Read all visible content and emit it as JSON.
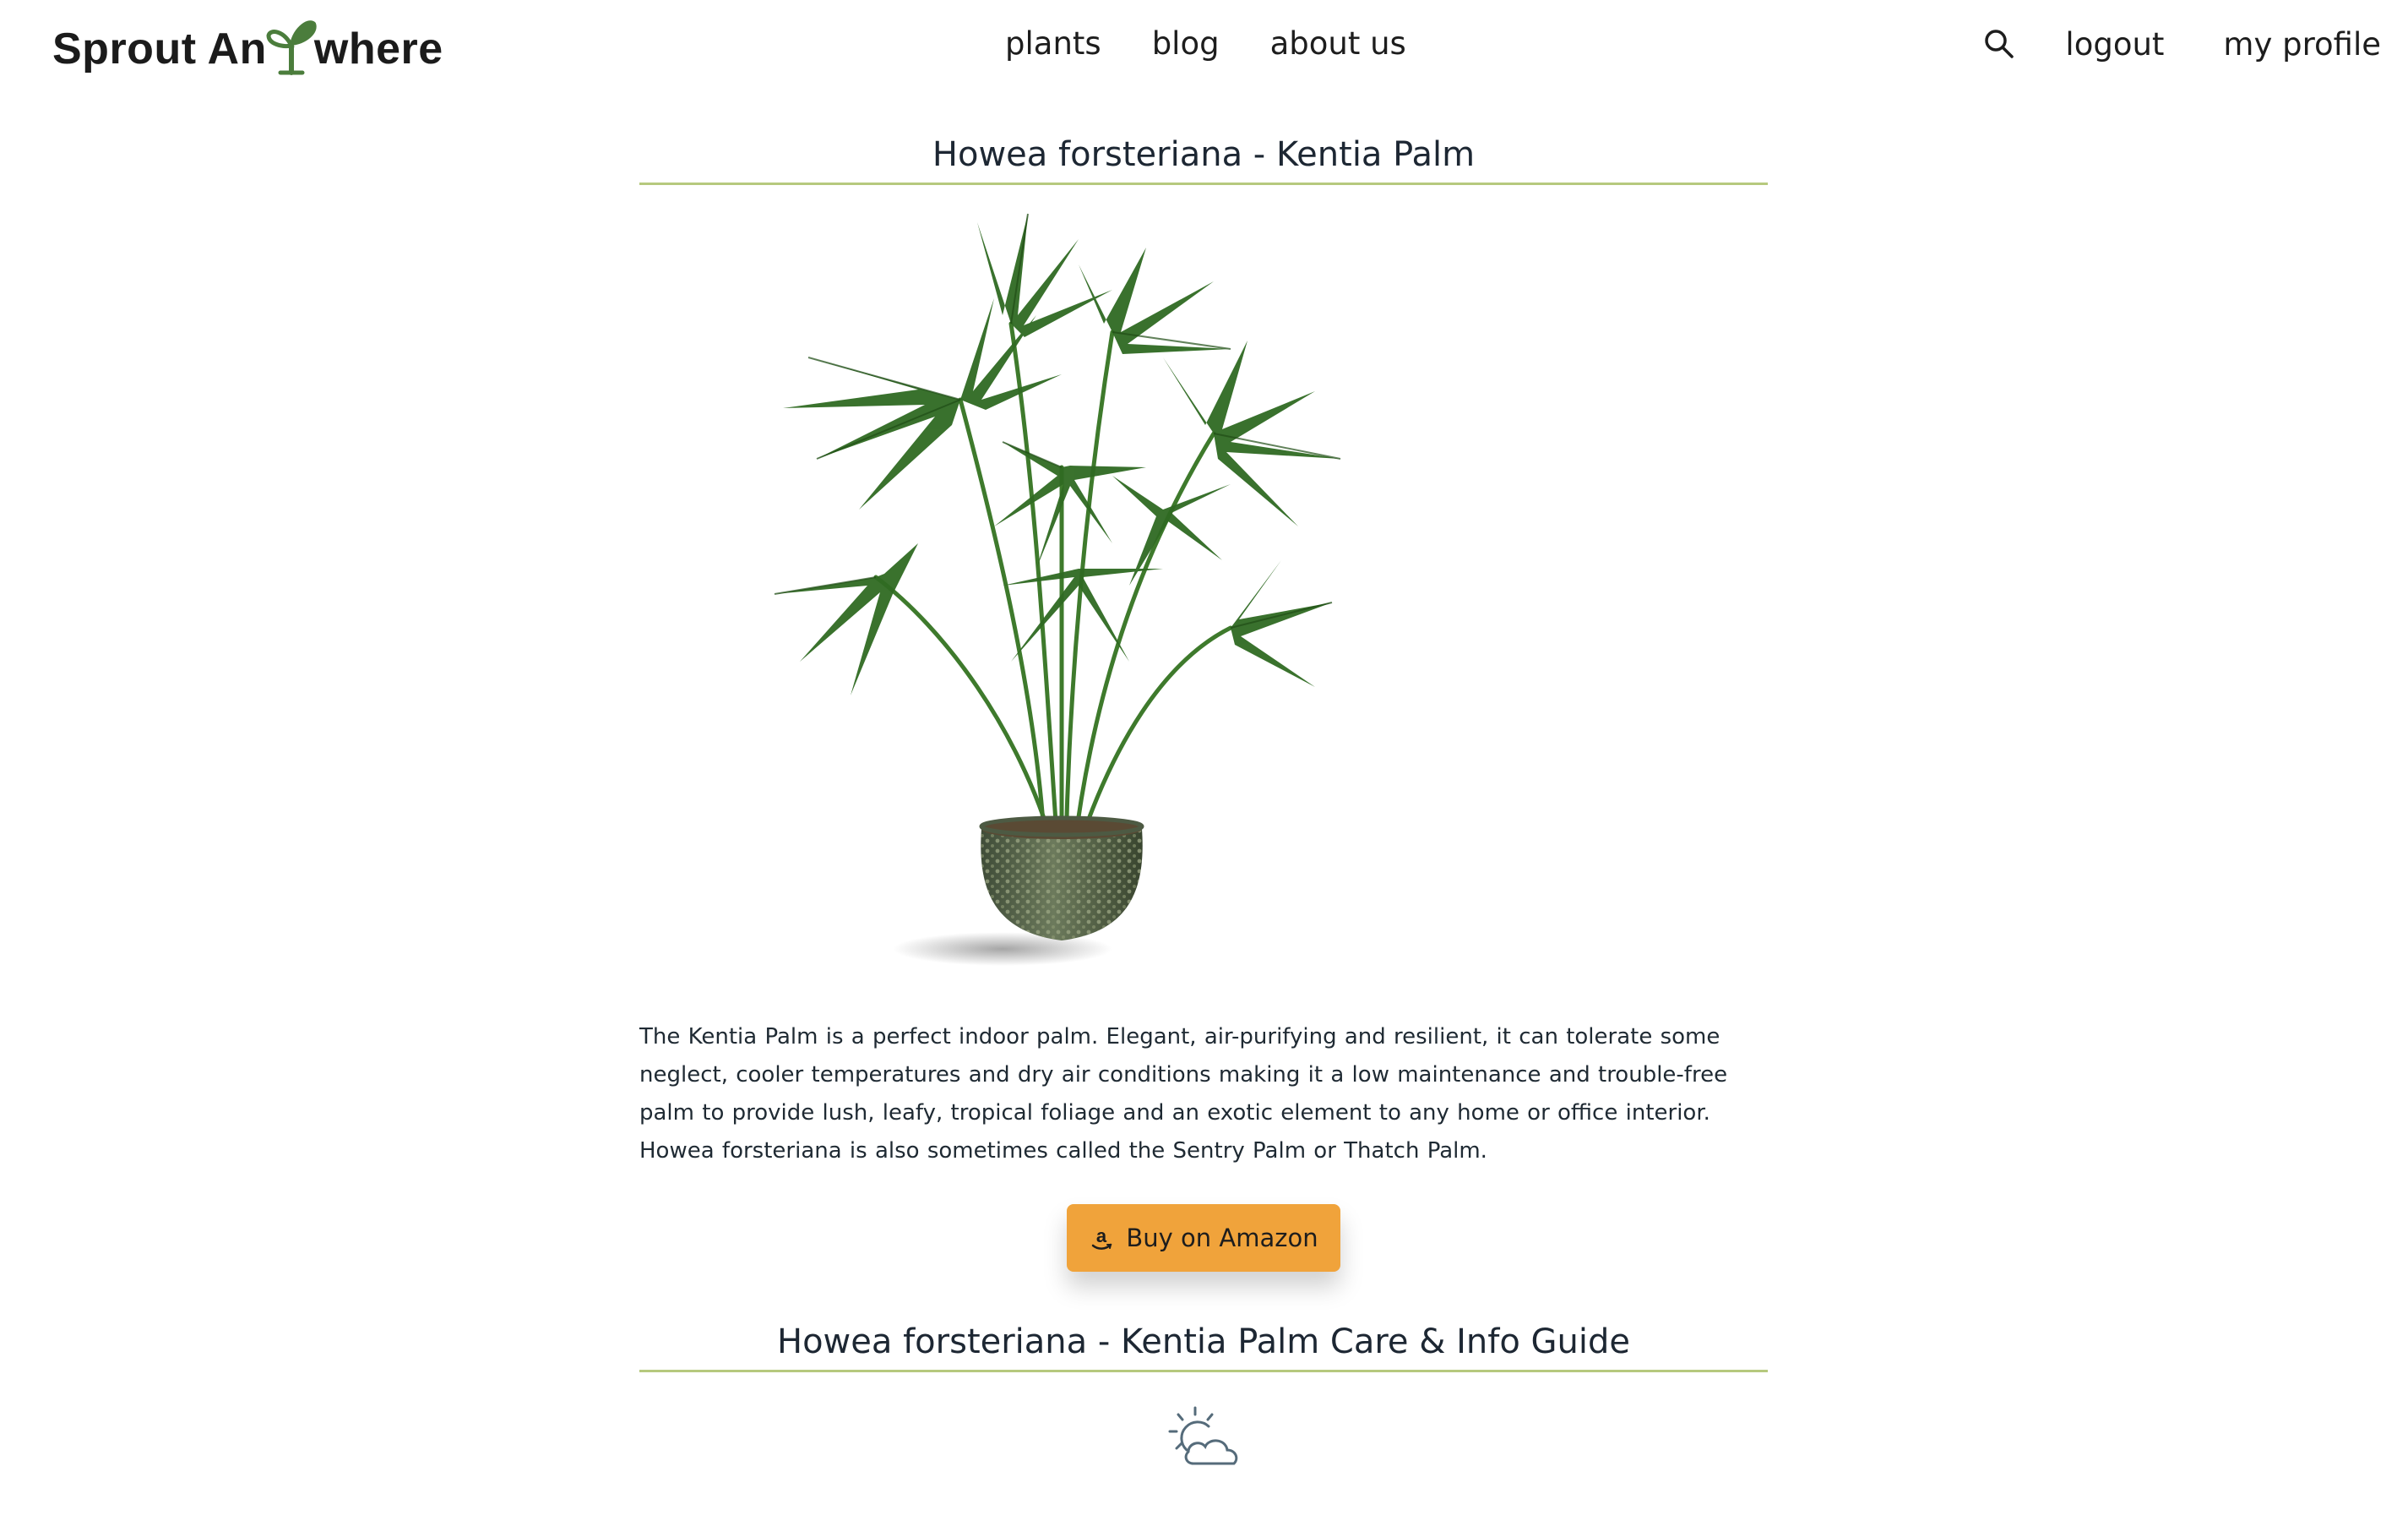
{
  "header": {
    "logo_text_left": "Sprout An",
    "logo_text_right": "where",
    "logo_brand_color": "#4b7d3c",
    "nav": [
      {
        "label": "plants"
      },
      {
        "label": "blog"
      },
      {
        "label": "about us"
      }
    ],
    "search_icon": "search-icon",
    "logout_label": "logout",
    "profile_label": "my profile"
  },
  "plant": {
    "title": "Howea forsteriana - Kentia Palm",
    "description": "The Kentia Palm is a perfect indoor palm. Elegant, air-purifying and resilient, it can tolerate some neglect, cooler temperatures and dry air conditions making it a low maintenance and trouble-free palm to provide lush, leafy, tropical foliage and an exotic element to any home or office interior. Howea forsteriana is also sometimes called the Sentry Palm or Thatch Palm.",
    "buy_button_label": "Buy on Amazon",
    "buy_button_icon": "amazon-icon",
    "buy_button_color": "#f0a33b",
    "guide_title": "Howea forsteriana - Kentia Palm Care & Info Guide",
    "guide_icon": "partly-sunny-icon",
    "accent_line_color": "#b6c97e"
  }
}
